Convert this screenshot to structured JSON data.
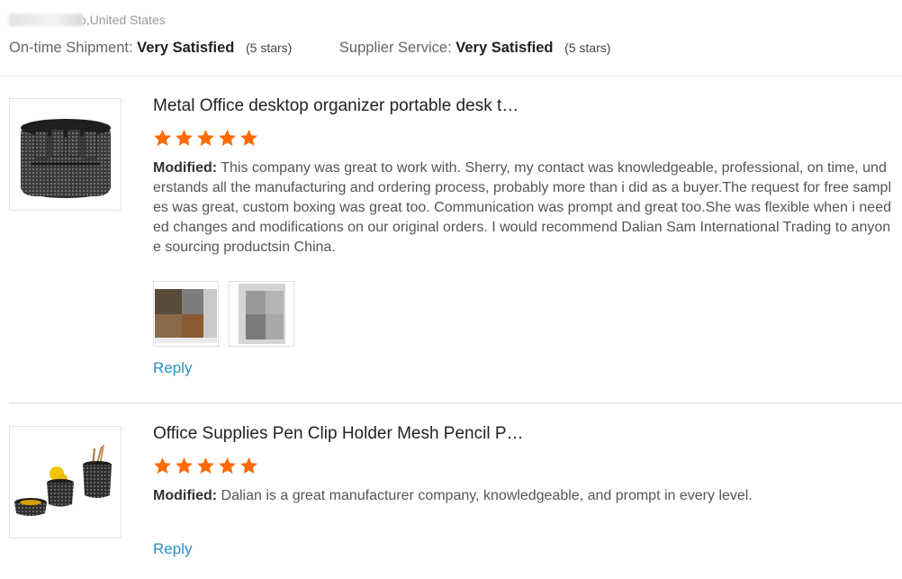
{
  "buyer": {
    "location": "o,United States"
  },
  "shop_ratings": [
    {
      "label": "On-time Shipment:",
      "value": "Very Satisfied",
      "stars": "(5 stars)"
    },
    {
      "label": "Supplier Service:",
      "value": "Very Satisfied",
      "stars": "(5 stars)"
    }
  ],
  "reviews": [
    {
      "title": "Metal Office desktop organizer portable desk t…",
      "rating": 5,
      "label": "Modified:",
      "text": "This company was great to work with. Sherry, my contact was knowledgeable, professional, on time, understands all the manufacturing and ordering process, probably more than i did as a buyer.The request for free samples was great, custom boxing was great too. Communication was prompt and great too.She was flexible when i needed changes and modifications on our original orders. I would recommend Dalian Sam International Trading to anyone sourcing productsin China.",
      "reply_label": "Reply"
    },
    {
      "title": "Office Supplies Pen Clip Holder Mesh Pencil P…",
      "rating": 5,
      "label": "Modified:",
      "text": "Dalian is a great manufacturer company, knowledgeable, and prompt in every level.",
      "reply_label": "Reply"
    }
  ],
  "colors": {
    "star": "#ff6a00",
    "reply_link": "#2d8fcb"
  }
}
